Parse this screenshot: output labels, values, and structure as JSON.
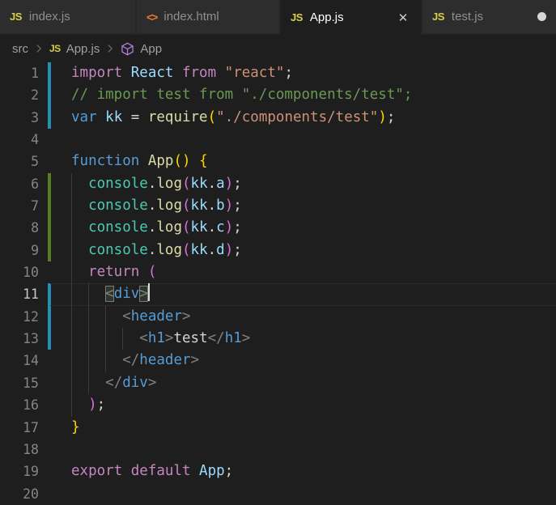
{
  "icons": {
    "js": "JS",
    "html": "<>",
    "close": "✕"
  },
  "colors": {
    "ui": {
      "tabbar_bg": "#252526",
      "tab_inactive_bg": "#2d2d2d",
      "tab_active_bg": "#1e1e1e",
      "tab_inactive_fg": "#8f8f8f",
      "tab_active_fg": "#ffffff",
      "js_icon": "#d8ce4d",
      "html_icon": "#e37933",
      "modified_dot": "#d7d7d7",
      "breadcrumb_fg": "#a0a0a0",
      "symbol_icon": "#b180d7",
      "editor_bg": "#1e1e1e",
      "line_number": "#858585",
      "current_line_number": "#c6c6c6",
      "gutter_modified": "#2391b4",
      "gutter_added": "#5a7d1e"
    },
    "syntax": {
      "kw": "#c586c0",
      "decl": "#569cd6",
      "var": "#9cdcfe",
      "str": "#ce9178",
      "com": "#6a9955",
      "fn": "#dcdcaa",
      "cls": "#4ec9b0",
      "pun": "#d4d4d4",
      "b1": "#ffd700",
      "b2": "#da70d6",
      "tag": "#808080",
      "txt": "#d4d4d4"
    }
  },
  "tabs": [
    {
      "label": "index.js",
      "icon": "js",
      "state": "inactive"
    },
    {
      "label": "index.html",
      "icon": "html",
      "state": "inactive"
    },
    {
      "label": "App.js",
      "icon": "js",
      "state": "active",
      "has_close": true
    },
    {
      "label": "test.js",
      "icon": "js",
      "state": "inactive",
      "modified_dot": true
    }
  ],
  "breadcrumb": {
    "items": [
      {
        "label": "src"
      },
      {
        "label": "App.js",
        "icon": "js"
      },
      {
        "label": "App",
        "icon": "symbol-method"
      }
    ]
  },
  "editor": {
    "cursor_line": 11,
    "lines": [
      {
        "n": 1,
        "gutter": "modified",
        "guides": 0,
        "segs": [
          {
            "c": "kw",
            "t": "import "
          },
          {
            "c": "var",
            "t": "React "
          },
          {
            "c": "kw",
            "t": "from "
          },
          {
            "c": "str",
            "t": "\"react\""
          },
          {
            "c": "pun",
            "t": ";"
          }
        ]
      },
      {
        "n": 2,
        "gutter": "modified",
        "guides": 0,
        "segs": [
          {
            "c": "com",
            "t": "// import test from \"./components/test\";"
          }
        ]
      },
      {
        "n": 3,
        "gutter": "modified",
        "guides": 0,
        "segs": [
          {
            "c": "decl",
            "t": "var "
          },
          {
            "c": "var",
            "t": "kk "
          },
          {
            "c": "pun",
            "t": "= "
          },
          {
            "c": "fn",
            "t": "require"
          },
          {
            "c": "b1",
            "t": "("
          },
          {
            "c": "str",
            "t": "\"./components/test\""
          },
          {
            "c": "b1",
            "t": ")"
          },
          {
            "c": "pun",
            "t": ";"
          }
        ]
      },
      {
        "n": 4,
        "gutter": null,
        "guides": 0,
        "segs": []
      },
      {
        "n": 5,
        "gutter": null,
        "guides": 0,
        "segs": [
          {
            "c": "decl",
            "t": "function "
          },
          {
            "c": "fn",
            "t": "App"
          },
          {
            "c": "b1",
            "t": "()"
          },
          {
            "c": "pun",
            "t": " "
          },
          {
            "c": "b1",
            "t": "{"
          }
        ]
      },
      {
        "n": 6,
        "gutter": "added",
        "guides": 1,
        "segs": [
          {
            "c": "pun",
            "t": "  "
          },
          {
            "c": "cls",
            "t": "console"
          },
          {
            "c": "pun",
            "t": "."
          },
          {
            "c": "fn",
            "t": "log"
          },
          {
            "c": "b2",
            "t": "("
          },
          {
            "c": "var",
            "t": "kk"
          },
          {
            "c": "pun",
            "t": "."
          },
          {
            "c": "var",
            "t": "a"
          },
          {
            "c": "b2",
            "t": ")"
          },
          {
            "c": "pun",
            "t": ";"
          }
        ]
      },
      {
        "n": 7,
        "gutter": "added",
        "guides": 1,
        "segs": [
          {
            "c": "pun",
            "t": "  "
          },
          {
            "c": "cls",
            "t": "console"
          },
          {
            "c": "pun",
            "t": "."
          },
          {
            "c": "fn",
            "t": "log"
          },
          {
            "c": "b2",
            "t": "("
          },
          {
            "c": "var",
            "t": "kk"
          },
          {
            "c": "pun",
            "t": "."
          },
          {
            "c": "var",
            "t": "b"
          },
          {
            "c": "b2",
            "t": ")"
          },
          {
            "c": "pun",
            "t": ";"
          }
        ]
      },
      {
        "n": 8,
        "gutter": "added",
        "guides": 1,
        "segs": [
          {
            "c": "pun",
            "t": "  "
          },
          {
            "c": "cls",
            "t": "console"
          },
          {
            "c": "pun",
            "t": "."
          },
          {
            "c": "fn",
            "t": "log"
          },
          {
            "c": "b2",
            "t": "("
          },
          {
            "c": "var",
            "t": "kk"
          },
          {
            "c": "pun",
            "t": "."
          },
          {
            "c": "var",
            "t": "c"
          },
          {
            "c": "b2",
            "t": ")"
          },
          {
            "c": "pun",
            "t": ";"
          }
        ]
      },
      {
        "n": 9,
        "gutter": "added",
        "guides": 1,
        "segs": [
          {
            "c": "pun",
            "t": "  "
          },
          {
            "c": "cls",
            "t": "console"
          },
          {
            "c": "pun",
            "t": "."
          },
          {
            "c": "fn",
            "t": "log"
          },
          {
            "c": "b2",
            "t": "("
          },
          {
            "c": "var",
            "t": "kk"
          },
          {
            "c": "pun",
            "t": "."
          },
          {
            "c": "var",
            "t": "d"
          },
          {
            "c": "b2",
            "t": ")"
          },
          {
            "c": "pun",
            "t": ";"
          }
        ]
      },
      {
        "n": 10,
        "gutter": null,
        "guides": 1,
        "segs": [
          {
            "c": "pun",
            "t": "  "
          },
          {
            "c": "kw",
            "t": "return "
          },
          {
            "c": "b2",
            "t": "("
          }
        ]
      },
      {
        "n": 11,
        "gutter": "modified",
        "guides": 2,
        "segs": [
          {
            "c": "pun",
            "t": "    "
          },
          {
            "c": "tag",
            "t": "<",
            "m": true
          },
          {
            "c": "decl",
            "t": "div"
          },
          {
            "c": "tag",
            "t": ">",
            "m": true
          }
        ]
      },
      {
        "n": 12,
        "gutter": "modified",
        "guides": 3,
        "segs": [
          {
            "c": "pun",
            "t": "      "
          },
          {
            "c": "tag",
            "t": "<"
          },
          {
            "c": "decl",
            "t": "header"
          },
          {
            "c": "tag",
            "t": ">"
          }
        ]
      },
      {
        "n": 13,
        "gutter": "modified",
        "guides": 4,
        "segs": [
          {
            "c": "pun",
            "t": "        "
          },
          {
            "c": "tag",
            "t": "<"
          },
          {
            "c": "decl",
            "t": "h1"
          },
          {
            "c": "tag",
            "t": ">"
          },
          {
            "c": "txt",
            "t": "test"
          },
          {
            "c": "tag",
            "t": "</"
          },
          {
            "c": "decl",
            "t": "h1"
          },
          {
            "c": "tag",
            "t": ">"
          }
        ]
      },
      {
        "n": 14,
        "gutter": null,
        "guides": 3,
        "segs": [
          {
            "c": "pun",
            "t": "      "
          },
          {
            "c": "tag",
            "t": "</"
          },
          {
            "c": "decl",
            "t": "header"
          },
          {
            "c": "tag",
            "t": ">"
          }
        ]
      },
      {
        "n": 15,
        "gutter": null,
        "guides": 2,
        "segs": [
          {
            "c": "pun",
            "t": "    "
          },
          {
            "c": "tag",
            "t": "</"
          },
          {
            "c": "decl",
            "t": "div"
          },
          {
            "c": "tag",
            "t": ">"
          }
        ]
      },
      {
        "n": 16,
        "gutter": null,
        "guides": 1,
        "segs": [
          {
            "c": "pun",
            "t": "  "
          },
          {
            "c": "b2",
            "t": ")"
          },
          {
            "c": "pun",
            "t": ";"
          }
        ]
      },
      {
        "n": 17,
        "gutter": null,
        "guides": 0,
        "segs": [
          {
            "c": "b1",
            "t": "}"
          }
        ]
      },
      {
        "n": 18,
        "gutter": null,
        "guides": 0,
        "segs": []
      },
      {
        "n": 19,
        "gutter": null,
        "guides": 0,
        "segs": [
          {
            "c": "kw",
            "t": "export default "
          },
          {
            "c": "var",
            "t": "App"
          },
          {
            "c": "pun",
            "t": ";"
          }
        ]
      },
      {
        "n": 20,
        "gutter": null,
        "guides": 0,
        "segs": []
      }
    ]
  }
}
